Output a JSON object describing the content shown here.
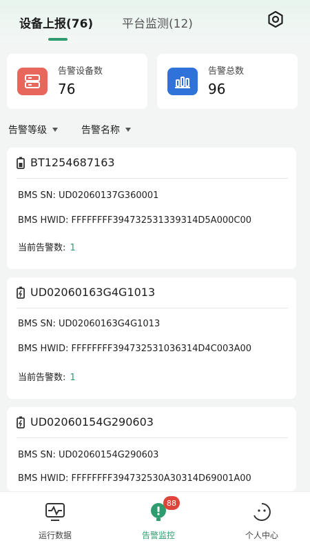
{
  "header": {
    "tabs": [
      {
        "label": "设备上报(76)"
      },
      {
        "label": "平台监测(12)"
      }
    ]
  },
  "stats": {
    "device_label": "告警设备数",
    "device_value": "76",
    "total_label": "告警总数",
    "total_value": "96"
  },
  "filters": {
    "level_label": "告警等级",
    "name_label": "告警名称"
  },
  "labels": {
    "bms_sn": "BMS SN:",
    "bms_hwid": "BMS HWID:",
    "current_alarms": "当前告警数:"
  },
  "devices": [
    {
      "title": "BT1254687163",
      "sn": "UD02060137G360001",
      "hwid": "FFFFFFFF394732531339314D5A000C00",
      "alarms": "1"
    },
    {
      "title": "UD02060163G4G1013",
      "sn": "UD02060163G4G1013",
      "hwid": "FFFFFFFF394732531036314D4C003A00",
      "alarms": "1"
    },
    {
      "title": "UD02060154G290603",
      "sn": "UD02060154G290603",
      "hwid": "FFFFFFFF394732530A30314D69001A00"
    }
  ],
  "bottom_nav": {
    "items": [
      {
        "label": "运行数据",
        "icon": "pulse-monitor-icon"
      },
      {
        "label": "告警监控",
        "icon": "alarm-monitor-icon",
        "badge": "88"
      },
      {
        "label": "个人中心",
        "icon": "person-face-icon"
      }
    ]
  },
  "colors": {
    "accent": "#2e9c6e",
    "device_icon_bg": "#e8675c",
    "total_icon_bg": "#2f72d9",
    "badge": "#e0443a"
  }
}
